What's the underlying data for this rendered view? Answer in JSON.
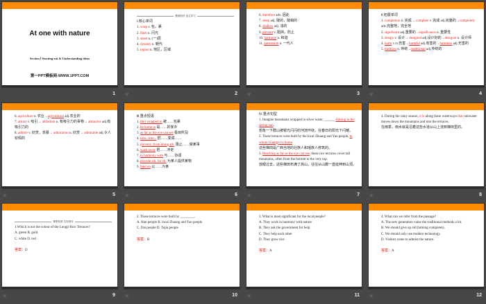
{
  "colors": {
    "accent": "#ff8c00",
    "answer": "#e8231e",
    "background": "#474747"
  },
  "title_slide": {
    "title": "At one with nature",
    "subtitle": "Section Ⅰ Starting out & Understanding ideas",
    "footer": "第一PPT模板网-WWW.1PPT.COM"
  },
  "slides": [
    {
      "number": "1",
      "star": false,
      "title_slide": true,
      "lines": []
    },
    {
      "number": "2",
      "star": true,
      "ornament": "基础知识·自主学习",
      "lines": [
        [
          [
            "Ⅰ.核心单词",
            ""
          ]
        ],
        [
          [
            "1. ",
            ""
          ],
          [
            "wrap",
            "r"
          ],
          [
            "  v.  包，裹",
            ""
          ]
        ],
        [
          [
            "2. ",
            ""
          ],
          [
            "flash",
            "r"
          ],
          [
            "  n.  闪光",
            ""
          ]
        ],
        [
          [
            "3. ",
            ""
          ],
          [
            "sheet",
            "r"
          ],
          [
            "  n.  (一)层",
            ""
          ]
        ],
        [
          [
            "4. ",
            ""
          ],
          [
            "dynasty",
            "r"
          ],
          [
            " n.  朝代",
            ""
          ]
        ],
        [
          [
            "5. ",
            ""
          ],
          [
            "region",
            "r"
          ],
          [
            "  n.  地区，区域",
            ""
          ]
        ]
      ]
    },
    {
      "number": "3",
      "star": true,
      "lines": [
        [
          [
            "6. ",
            ""
          ],
          [
            "therefore",
            "r"
          ],
          [
            "  adv.  因此",
            ""
          ]
        ],
        [
          [
            "7. ",
            ""
          ],
          [
            "steep",
            "r"
          ],
          [
            "   adj.  陡的，陡峭的",
            ""
          ]
        ],
        [
          [
            "8. ",
            ""
          ],
          [
            "shallow",
            "ru"
          ],
          [
            "  adj.  浅的",
            ""
          ]
        ],
        [
          [
            "9. ",
            ""
          ],
          [
            "prevent",
            "ru"
          ],
          [
            "  v.  阻挡，防止",
            ""
          ]
        ],
        [
          [
            "10. ",
            ""
          ],
          [
            "harmony",
            "ru"
          ],
          [
            "  n.  和谐",
            ""
          ]
        ],
        [
          [
            "11. ",
            ""
          ],
          [
            "generation",
            "ru"
          ],
          [
            "  n.  一代人",
            ""
          ]
        ]
      ]
    },
    {
      "number": "4",
      "star": true,
      "lines": [
        [
          [
            "Ⅱ.拓展单词",
            ""
          ]
        ],
        [
          [
            "1. ",
            ""
          ],
          [
            "completion",
            "r"
          ],
          [
            " n. 完成→ ",
            ""
          ],
          [
            "complete",
            "r"
          ],
          [
            " v. 完成  adj.完整的→",
            ""
          ],
          [
            "completely",
            "r"
          ],
          [
            " adv.完整地，完全地",
            ""
          ]
        ],
        [
          [
            "2. ",
            ""
          ],
          [
            "significant",
            "r"
          ],
          [
            " adj.重要的→",
            ""
          ],
          [
            "significance",
            "r"
          ],
          [
            " n. 重要性",
            ""
          ]
        ],
        [
          [
            "3. ",
            ""
          ],
          [
            "design",
            "r"
          ],
          [
            "  v. 设计→ ",
            ""
          ],
          [
            "designed",
            "r"
          ],
          [
            " adj.设计好的→",
            ""
          ],
          [
            "designer",
            "r"
          ],
          [
            " n. 设计师",
            ""
          ]
        ],
        [
          [
            "4. ",
            ""
          ],
          [
            "harm",
            "ru"
          ],
          [
            "  v./n.伤害→",
            ""
          ],
          [
            "harmful",
            "ru"
          ],
          [
            " adj.有害的→",
            ""
          ],
          [
            "harmless",
            "ru"
          ],
          [
            " adj.无害的",
            ""
          ]
        ],
        [
          [
            "5. ",
            ""
          ],
          [
            "tradition",
            "ru"
          ],
          [
            "  n. 传统→",
            ""
          ],
          [
            "traditional",
            "ru"
          ],
          [
            " adj.传统的",
            ""
          ]
        ]
      ]
    },
    {
      "number": "5",
      "star": true,
      "lines": [
        [
          [
            "6. ",
            ""
          ],
          [
            "agriculture",
            "r"
          ],
          [
            "  n. 农业→",
            ""
          ],
          [
            "agricultural",
            "ru"
          ],
          [
            " adj.农业的",
            ""
          ]
        ],
        [
          [
            "7. ",
            ""
          ],
          [
            "attract",
            "r"
          ],
          [
            "  v. 吸引→ ",
            ""
          ],
          [
            "attraction",
            "r"
          ],
          [
            " n. 有吸引力的事物→ ",
            ""
          ],
          [
            "attractive",
            "r"
          ],
          [
            " adj.有吸引力的",
            ""
          ]
        ],
        [
          [
            "8. ",
            ""
          ],
          [
            "admire",
            "r"
          ],
          [
            " v. 欣赏，羡慕→ ",
            ""
          ],
          [
            "admiration",
            "r"
          ],
          [
            "   n. 欣赏→ ",
            ""
          ],
          [
            "admirable",
            "r"
          ],
          [
            " adj.令人钦佩的",
            ""
          ]
        ]
      ]
    },
    {
      "number": "6",
      "star": true,
      "lines": [
        [
          [
            "Ⅲ.重点短语",
            ""
          ]
        ],
        [
          [
            "1. ",
            ""
          ],
          [
            "(be) wrapped in",
            "ru"
          ],
          [
            "  被……包裹",
            ""
          ]
        ],
        [
          [
            "2. ",
            ""
          ],
          [
            "be home to",
            "ru"
          ],
          [
            "  是……的家乡",
            ""
          ]
        ],
        [
          [
            "3. ",
            ""
          ],
          [
            "as far as the eye can see",
            "ru"
          ],
          [
            "  极目所及",
            ""
          ]
        ],
        [
          [
            "4. ",
            ""
          ],
          [
            "turn...into...",
            "ru"
          ],
          [
            "  把……变成……",
            ""
          ]
        ],
        [
          [
            "5. ",
            ""
          ],
          [
            "prevent...from doing sth.",
            "ru"
          ],
          [
            "  阻止……做某事",
            ""
          ]
        ],
        [
          [
            "6. ",
            ""
          ],
          [
            "wash away",
            "ru"
          ],
          [
            "  把……冲走",
            ""
          ]
        ],
        [
          [
            "7. ",
            ""
          ],
          [
            "in harmony with",
            "ru"
          ],
          [
            "  与……协调",
            ""
          ]
        ],
        [
          [
            "8. ",
            ""
          ],
          [
            "provide sth. for sb.",
            "ru"
          ],
          [
            "  为某人提供某物",
            ""
          ]
        ],
        [
          [
            "9. ",
            ""
          ],
          [
            "feed on",
            "ru"
          ],
          [
            "  以……为食",
            ""
          ]
        ]
      ]
    },
    {
      "number": "7",
      "star": true,
      "lines": [
        [
          [
            "Ⅳ.重点句型",
            ""
          ]
        ],
        [
          [
            "1. Imagine mountains wrapped in silver water, ______ ",
            ""
          ],
          [
            "shining in the spring sun",
            "ru"
          ],
          [
            ".",
            ""
          ]
        ],
        [
          [
            "想象一下群山被银光闪闪的河流环绕，在春日的阳光下闪耀。",
            ""
          ]
        ],
        [
          [
            "2. These terraces were built by the local Zhuang and Yao people, ",
            ""
          ],
          [
            "to whom Guangxi is home",
            "ru"
          ],
          [
            ".",
            ""
          ]
        ],
        [
          [
            "这些梯田是广西当地的壮族人和瑶族人修筑的。",
            ""
          ]
        ],
        [
          [
            "3. ",
            ""
          ],
          [
            "Reaching as far as the eye can see",
            "ru"
          ],
          [
            ", these rice terraces cover tall mountains, often from the bottom to the very top.",
            ""
          ]
        ],
        [
          [
            "放眼过去，这些梯田布满了高山，往往从山脚一直延伸到山顶。",
            ""
          ]
        ]
      ]
    },
    {
      "number": "8",
      "star": true,
      "lines": [
        [
          [
            "4. During the rainy season, ",
            ""
          ],
          [
            "it is",
            "r"
          ],
          [
            " along these waterways ",
            ""
          ],
          [
            "that",
            "r"
          ],
          [
            " rainwater moves down the mountains and into the terraces.",
            ""
          ]
        ],
        [
          [
            "在雨季，雨水就是沿着这些水道从山上流到梯田里的。",
            ""
          ]
        ]
      ]
    },
    {
      "number": "9",
      "star": true,
      "ornament": "课堂检测·达标测评",
      "lines": [
        [
          [
            "1.Which is not the colour of the Longji Rice Terraces?",
            ""
          ]
        ],
        [
          [
            "A. green                              B. gold",
            ""
          ]
        ],
        [
          [
            "C. white                               D. red",
            ""
          ]
        ],
        [
          [
            "",
            ""
          ]
        ],
        [
          [
            "答案：",
            "r"
          ],
          [
            "D",
            ""
          ]
        ]
      ]
    },
    {
      "number": "10",
      "star": true,
      "lines": [
        [
          [
            "2. These terraces were built by ________.",
            ""
          ]
        ],
        [
          [
            "A. Han people  B. local Zhuang and Yao people",
            ""
          ]
        ],
        [
          [
            "C. Dai people  D. Tujia people",
            ""
          ]
        ],
        [
          [
            "",
            ""
          ]
        ],
        [
          [
            "答案：",
            "r"
          ],
          [
            "B",
            ""
          ]
        ]
      ]
    },
    {
      "number": "11",
      "star": true,
      "lines": [
        [
          [
            "3. What is most significant for the local people?",
            ""
          ]
        ],
        [
          [
            "A. They work in harmony with nature",
            ""
          ]
        ],
        [
          [
            "B. They ask the government for help",
            ""
          ]
        ],
        [
          [
            "C. They help each other",
            ""
          ]
        ],
        [
          [
            "D. They grow rice",
            ""
          ]
        ],
        [
          [
            "",
            ""
          ]
        ],
        [
          [
            "答案：",
            "r"
          ],
          [
            "A",
            ""
          ]
        ]
      ]
    },
    {
      "number": "12",
      "star": true,
      "lines": [
        [
          [
            "4. What can we infer from the passage?",
            ""
          ]
        ],
        [
          [
            "A. The new generation value the traditional methods a lot.",
            ""
          ]
        ],
        [
          [
            "B. We should give up old farming completely.",
            ""
          ]
        ],
        [
          [
            "C. We should only use modern technology.",
            ""
          ]
        ],
        [
          [
            "D. Visitors come to admire the nature.",
            ""
          ]
        ],
        [
          [
            "",
            ""
          ]
        ],
        [
          [
            "答案：",
            "r"
          ],
          [
            "A",
            ""
          ]
        ]
      ]
    }
  ]
}
